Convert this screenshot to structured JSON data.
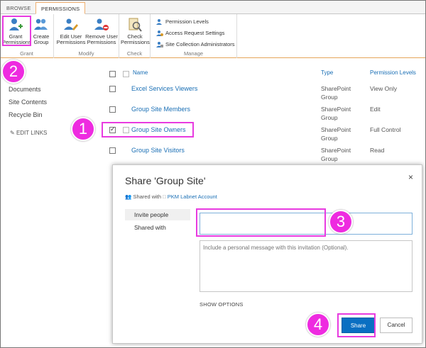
{
  "ribbon": {
    "tabs": [
      "BROWSE",
      "PERMISSIONS"
    ],
    "groups": {
      "grant": "Grant",
      "modify": "Modify",
      "check": "Check",
      "manage": "Manage"
    },
    "buttons": {
      "grant_permissions": "Grant Permissions",
      "create_group": "Create Group",
      "edit_user_permissions": "Edit User Permissions",
      "remove_user_permissions": "Remove User Permissions",
      "check_permissions": "Check Permissions",
      "permission_levels": "Permission Levels",
      "access_request_settings": "Access Request Settings",
      "site_collection_administrators": "Site Collection Administrators"
    }
  },
  "left_nav": {
    "items": [
      "Documents",
      "Site Contents",
      "Recycle Bin"
    ],
    "edit_links": "EDIT LINKS"
  },
  "list": {
    "headers": {
      "name": "Name",
      "type": "Type",
      "level": "Permission Levels"
    },
    "rows": [
      {
        "name": "Excel Services Viewers",
        "type1": "SharePoint",
        "type2": "Group",
        "level": "View Only",
        "checked": false
      },
      {
        "name": "Group Site Members",
        "type1": "SharePoint",
        "type2": "Group",
        "level": "Edit",
        "checked": false
      },
      {
        "name": "Group Site Owners",
        "type1": "SharePoint",
        "type2": "Group",
        "level": "Full Control",
        "checked": true
      },
      {
        "name": "Group Site Visitors",
        "type1": "SharePoint",
        "type2": "Group",
        "level": "Read",
        "checked": false
      }
    ]
  },
  "dialog": {
    "title": "Share 'Group Site'",
    "close": "×",
    "shared_with_label": "Shared with",
    "shared_with_account": "PKM Labnet Account",
    "nav": [
      "Invite people",
      "Shared with"
    ],
    "invite_value": "",
    "message_placeholder": "Include a personal message with this invitation (Optional).",
    "show_options": "SHOW OPTIONS",
    "share": "Share",
    "cancel": "Cancel"
  },
  "callouts": [
    "1",
    "2",
    "3",
    "4"
  ],
  "colors": {
    "accent": "#0a6fc2",
    "highlight": "#e83be0",
    "link": "#1a6fb5"
  }
}
